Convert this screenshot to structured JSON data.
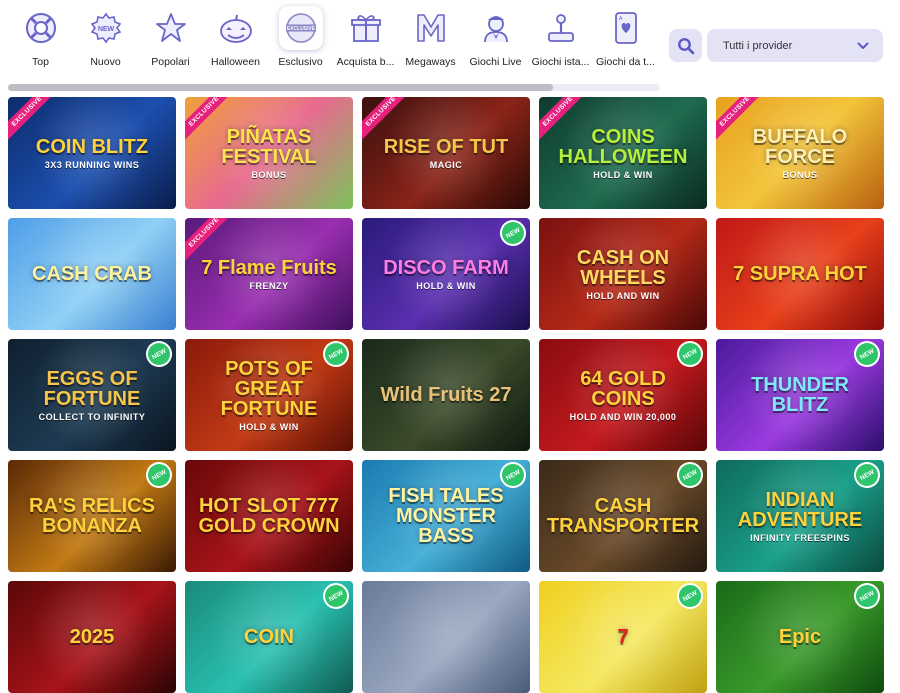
{
  "categories": [
    {
      "label": "Top",
      "icon": "lifebuoy-icon",
      "active": false
    },
    {
      "label": "Nuovo",
      "icon": "new-badge-icon",
      "active": false
    },
    {
      "label": "Popolari",
      "icon": "star-icon",
      "active": false
    },
    {
      "label": "Halloween",
      "icon": "pumpkin-icon",
      "active": false
    },
    {
      "label": "Esclusivo",
      "icon": "exclusive-badge-icon",
      "active": true
    },
    {
      "label": "Acquista b...",
      "icon": "gift-icon",
      "active": false
    },
    {
      "label": "Megaways",
      "icon": "megaways-icon",
      "active": false
    },
    {
      "label": "Giochi Live",
      "icon": "dealer-icon",
      "active": false
    },
    {
      "label": "Giochi ista...",
      "icon": "joystick-icon",
      "active": false
    },
    {
      "label": "Giochi da t...",
      "icon": "playing-card-icon",
      "active": false
    }
  ],
  "search": {
    "icon": "search-icon"
  },
  "provider_select": {
    "value": "Tutti i provider",
    "icon": "chevron-down-icon"
  },
  "badges": {
    "exclusive": "EXCLUSIVE",
    "new": "NEW"
  },
  "colors": {
    "accent": "#5b56c9",
    "panel": "#e4e3f6",
    "exclusive": "#e6217d",
    "new": "#2fc56a"
  },
  "games": [
    {
      "title": "COIN BLITZ",
      "sub": "3X3 RUNNING WINS",
      "exclusive": true,
      "new": false,
      "bg": "linear-gradient(135deg,#0d2c6b,#1c4fb0 55%,#0a1d4a)",
      "color": "#ffd23c"
    },
    {
      "title": "PIÑATAS FESTIVAL",
      "sub": "BONUS",
      "exclusive": true,
      "new": false,
      "bg": "linear-gradient(135deg,#f0a13a,#e86a8f 50%,#7cc35a)",
      "color": "#ffe34d"
    },
    {
      "title": "RISE OF TUT",
      "sub": "MAGIC",
      "exclusive": true,
      "new": false,
      "bg": "linear-gradient(135deg,#3a0f0f,#8a2418 55%,#2a0a06)",
      "color": "#f6c64a"
    },
    {
      "title": "COINS HALLOWEEN",
      "sub": "HOLD & WIN",
      "exclusive": true,
      "new": false,
      "bg": "linear-gradient(135deg,#0f3a2e,#1f6b4f 55%,#0a2a20)",
      "color": "#b6f03c"
    },
    {
      "title": "BUFFALO FORCE",
      "sub": "BONUS",
      "exclusive": true,
      "new": false,
      "bg": "linear-gradient(135deg,#e8a020,#f3c53a 50%,#b86010)",
      "color": "#ffefb0"
    },
    {
      "title": "CASH CRAB",
      "sub": "",
      "exclusive": false,
      "new": false,
      "bg": "linear-gradient(135deg,#4f9ee8,#8fd0f5 55%,#3a7fd0)",
      "color": "#fff3a0"
    },
    {
      "title": "7 Flame Fruits",
      "sub": "FRENZY",
      "exclusive": true,
      "new": false,
      "bg": "linear-gradient(135deg,#5a1a7a,#9a2fb0 55%,#3e0f5c)",
      "color": "#ffd23c"
    },
    {
      "title": "DISCO FARM",
      "sub": "HOLD & WIN",
      "exclusive": false,
      "new": true,
      "bg": "linear-gradient(135deg,#2a1a7a,#5a2fb0 55%,#1a0f4c)",
      "color": "#ff7be6"
    },
    {
      "title": "CASH ON WHEELS",
      "sub": "HOLD AND WIN",
      "exclusive": false,
      "new": false,
      "bg": "linear-gradient(135deg,#7a1010,#b52a18 55%,#4a0808)",
      "color": "#ffd860"
    },
    {
      "title": "7 SUPRA HOT",
      "sub": "",
      "exclusive": false,
      "new": false,
      "bg": "linear-gradient(135deg,#c01818,#e8401a 55%,#8a0c0c)",
      "color": "#ffd23c"
    },
    {
      "title": "EGGS OF FORTUNE",
      "sub": "COLLECT TO INFINITY",
      "exclusive": false,
      "new": true,
      "bg": "linear-gradient(135deg,#0f2030,#1e3a52 55%,#0a1520)",
      "color": "#f6c64a"
    },
    {
      "title": "POTS OF GREAT FORTUNE",
      "sub": "HOLD & WIN",
      "exclusive": false,
      "new": true,
      "bg": "linear-gradient(135deg,#8a1a0c,#c23a14 55%,#5a0f06)",
      "color": "#ffd23c"
    },
    {
      "title": "Wild Fruits 27",
      "sub": "",
      "exclusive": false,
      "new": false,
      "bg": "linear-gradient(135deg,#1a2a1a,#3a4a2a 55%,#101a10)",
      "color": "#e8c27a"
    },
    {
      "title": "64 GOLD COINS",
      "sub": "HOLD AND WIN 20,000",
      "exclusive": false,
      "new": true,
      "bg": "linear-gradient(135deg,#8a0c10,#c21a1e 55%,#5a0608)",
      "color": "#ffd23c"
    },
    {
      "title": "THUNDER BLITZ",
      "sub": "",
      "exclusive": false,
      "new": true,
      "bg": "linear-gradient(135deg,#4a1a9a,#9a3ae0 55%,#2a0f6a)",
      "color": "#7fe8ff"
    },
    {
      "title": "RA'S RELICS BONANZA",
      "sub": "",
      "exclusive": false,
      "new": true,
      "bg": "linear-gradient(135deg,#5a2a08,#c27a14 55%,#3a1a04)",
      "color": "#ffd23c"
    },
    {
      "title": "HOT SLOT 777 GOLD CROWN",
      "sub": "",
      "exclusive": false,
      "new": false,
      "bg": "linear-gradient(135deg,#6a0808,#a8141a 55%,#3a0404)",
      "color": "#ffd23c"
    },
    {
      "title": "FISH TALES MONSTER BASS",
      "sub": "",
      "exclusive": false,
      "new": true,
      "bg": "linear-gradient(135deg,#1a7ab0,#46b0d8 55%,#0f5a82)",
      "color": "#fff3a0"
    },
    {
      "title": "CASH TRANSPORTER",
      "sub": "",
      "exclusive": false,
      "new": true,
      "bg": "linear-gradient(135deg,#3a2a1a,#6a4a2a 55%,#241a10)",
      "color": "#ffd23c"
    },
    {
      "title": "INDIAN ADVENTURE",
      "sub": "INFINITY FREESPINS",
      "exclusive": false,
      "new": true,
      "bg": "linear-gradient(135deg,#0f6a5a,#1aa08a 55%,#0a4a3e)",
      "color": "#ffd23c"
    },
    {
      "title": "2025",
      "sub": "",
      "exclusive": false,
      "new": false,
      "bg": "linear-gradient(135deg,#5a0808,#a8141a 55%,#2a0404)",
      "color": "#ffd23c"
    },
    {
      "title": "COIN",
      "sub": "",
      "exclusive": false,
      "new": true,
      "bg": "linear-gradient(135deg,#1a8a7a,#2ac0b0 55%,#0f5a50)",
      "color": "#ffd23c"
    },
    {
      "title": "",
      "sub": "",
      "exclusive": false,
      "new": false,
      "bg": "linear-gradient(135deg,#6a7a9a,#9aa8c0 55%,#4a5a7a)",
      "color": "#ffd23c"
    },
    {
      "title": "7",
      "sub": "",
      "exclusive": false,
      "new": true,
      "bg": "linear-gradient(135deg,#f0d020,#f5e860 55%,#c0a010)",
      "color": "#e8201a"
    },
    {
      "title": "Epic",
      "sub": "",
      "exclusive": false,
      "new": true,
      "bg": "linear-gradient(135deg,#1a6a1a,#3a9a2a 55%,#0f4a0f)",
      "color": "#ffd23c"
    }
  ]
}
